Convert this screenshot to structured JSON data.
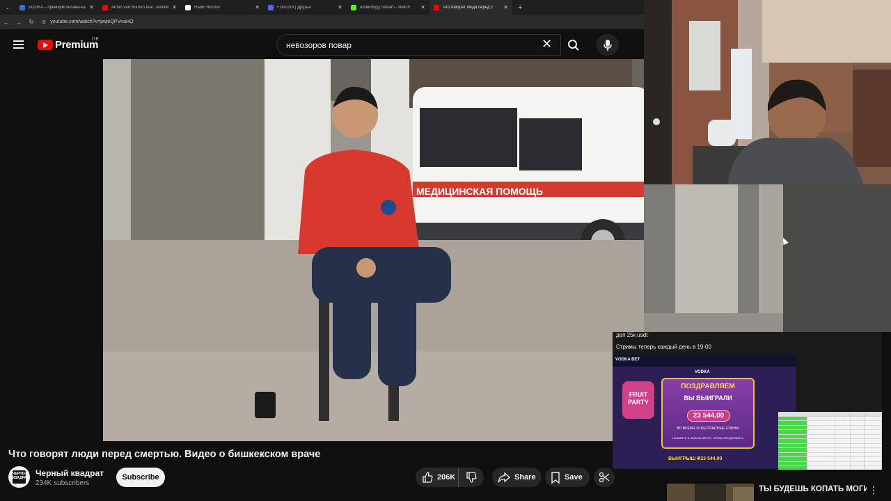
{
  "browser": {
    "tabs": [
      {
        "title": "VODKA – премиум онлайн-ка",
        "color": "#3a6fd8",
        "active": false
      },
      {
        "title": "Armin van Buuren feat. Jennife",
        "color": "#ff0000",
        "active": false
      },
      {
        "title": "Radio Record",
        "color": "#ffffff",
        "active": false
      },
      {
        "title": "• Discord | Друзья",
        "color": "#5865f2",
        "active": false
      },
      {
        "title": "underd0gg Stream - Watch",
        "color": "#53fc18",
        "active": false
      },
      {
        "title": "Что говорят люди перед с",
        "color": "#ff0000",
        "active": true
      }
    ],
    "new_tab": "+",
    "url": "youtube.com/watch?v=pwjeQPVnaHQ"
  },
  "youtube": {
    "logo_text": "Premium",
    "country": "GE",
    "search_query": "невозоров повар"
  },
  "video": {
    "title": "Что говорят люди перед смертью. Видео о бишкекском враче",
    "scene_text": "МЕДИЦИНСКАЯ ПОМОЩЬ"
  },
  "channel": {
    "name": "Черный квадрат",
    "subscribers": "234K subscribers",
    "avatar_text": "ЧЕРНЫЙ КВАДРАТ",
    "subscribe_label": "Subscribe"
  },
  "actions": {
    "likes": "206K",
    "share_label": "Share",
    "save_label": "Save"
  },
  "stream": {
    "chat_line_1": "деп 25к  usdt",
    "chat_line_2": "Стримы теперь каждый день в 19-00",
    "casino_brand": "VODKA BET",
    "casino_game_brand": "VODKA",
    "game_logo": "FRUIT PARTY",
    "congrats_1": "ПОЗДРАВЛЯЕМ",
    "congrats_2": "ВЫ ВЫИГРАЛИ",
    "win_amount": "23 544,00",
    "free_spins": "ВО ВРЕМЯ 20 БЕСПЛАТНЫЕ СПИНЫ",
    "press_anywhere": "НАЖМИТЕ В ЛЮБОМ МЕСТЕ, ЧТОБЫ ПРОДОЛЖИТЬ",
    "bottom_win": "ВЫИГРЫШ ₽23 544,00"
  },
  "recommended": {
    "title": "ТЫ БУДЕШЬ КОПАТЬ МОГИЛУ СВОЕМУ ДРУГУ | История"
  }
}
